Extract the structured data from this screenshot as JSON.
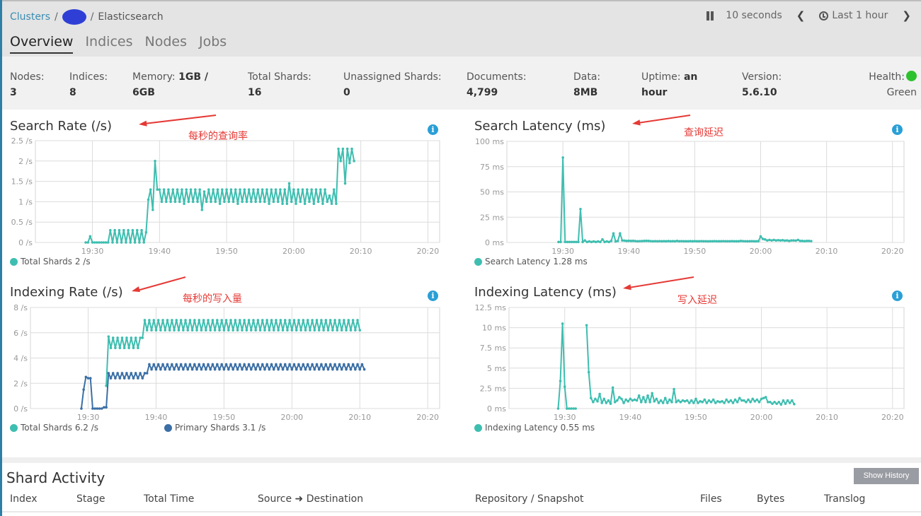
{
  "header": {
    "breadcrumb": {
      "clusters": "Clusters",
      "sep": "/",
      "current": "Elasticsearch"
    },
    "tabs": [
      {
        "label": "Overview",
        "active": true
      },
      {
        "label": "Indices",
        "active": false
      },
      {
        "label": "Nodes",
        "active": false
      },
      {
        "label": "Jobs",
        "active": false
      }
    ],
    "controls": {
      "pause_icon": "pause-icon",
      "refresh_interval": "10 seconds",
      "prev_icon": "chevron-left-icon",
      "clock_icon": "clock-icon",
      "time_range": "Last 1 hour",
      "next_icon": "chevron-right-icon"
    }
  },
  "stats": {
    "nodes": {
      "label": "Nodes:",
      "value": "3"
    },
    "indices": {
      "label": "Indices:",
      "value": "8"
    },
    "memory": {
      "label": "Memory:",
      "value_a": "1GB /",
      "value_b": "6GB"
    },
    "total_shards": {
      "label": "Total Shards:",
      "value": "16"
    },
    "unassigned_shards": {
      "label": "Unassigned Shards:",
      "value": "0"
    },
    "documents": {
      "label": "Documents:",
      "value": "4,799"
    },
    "data": {
      "label": "Data:",
      "value": "8MB"
    },
    "uptime": {
      "label": "Uptime:",
      "value_a": "an",
      "value_b": "hour"
    },
    "version": {
      "label": "Version:",
      "value": "5.6.10"
    },
    "health": {
      "label": "Health:",
      "value": "Green",
      "color": "#2ec12e"
    }
  },
  "colors": {
    "teal": "#3ebeb0",
    "blue": "#3b6fa6",
    "annotation": "#e53935",
    "info": "#2a9fd6"
  },
  "annotations": {
    "search_rate": "每秒的查询率",
    "search_latency": "查询延迟",
    "indexing_rate": "每秒的写入量",
    "indexing_latency": "写入延迟"
  },
  "chart_data": [
    {
      "id": "search_rate",
      "type": "line",
      "title": "Search Rate (/s)",
      "xlabel": "",
      "ylabel": "",
      "xlim": [
        "19:21:30",
        "20:21:45"
      ],
      "ylim": [
        0,
        2.5
      ],
      "yticks": [
        "0 /s",
        "0.5 /s",
        "1 /s",
        "1.5 /s",
        "2 /s",
        "2.5 /s"
      ],
      "ytick_values": [
        0,
        0.5,
        1,
        1.5,
        2,
        2.5
      ],
      "xticks": [
        "19:30",
        "19:40",
        "19:50",
        "20:00",
        "20:10",
        "20:20"
      ],
      "grid": true,
      "legend": [
        {
          "name": "Total Shards",
          "value": "2 /s",
          "color": "#3ebeb0"
        }
      ],
      "series": [
        {
          "name": "Total Shards",
          "color": "#3ebeb0",
          "x_start": "19:29:00",
          "x_step_seconds": 20,
          "values": [
            0,
            0,
            0.15,
            0,
            0,
            0,
            0,
            0,
            0,
            0,
            0,
            0.3,
            0,
            0.3,
            0,
            0.3,
            0,
            0.3,
            0,
            0.3,
            0,
            0.3,
            0,
            0.3,
            0,
            0.3,
            0,
            0.25,
            1.05,
            1.3,
            0.8,
            2,
            1.3,
            1.3,
            1,
            1.3,
            1,
            1.3,
            1,
            1.3,
            1,
            1.3,
            1,
            1.3,
            0.95,
            1.3,
            1,
            1.3,
            1,
            1.3,
            1,
            1.3,
            0.8,
            1.25,
            1,
            1.3,
            1,
            1.3,
            1,
            1.3,
            0.95,
            1.3,
            1,
            1.3,
            1,
            1.3,
            1,
            1.3,
            0.95,
            1.3,
            1,
            1.3,
            1,
            1.3,
            1,
            1.3,
            1,
            1.3,
            1,
            1.3,
            1,
            1.3,
            0.95,
            1.3,
            1,
            1.3,
            1,
            1.3,
            0.95,
            1.3,
            0.95,
            1.45,
            1,
            1.3,
            0.95,
            1.3,
            1,
            1.3,
            0.95,
            1.3,
            1,
            1.3,
            0.95,
            1.3,
            1,
            1.3,
            0.95,
            1.3,
            1,
            1.15,
            0.95,
            1.3,
            0.95,
            2.3,
            2,
            2.3,
            1.45,
            2.3,
            1.95,
            2.3,
            2
          ]
        }
      ]
    },
    {
      "id": "search_latency",
      "type": "line",
      "title": "Search Latency (ms)",
      "xlabel": "",
      "ylabel": "",
      "xlim": [
        "19:21:30",
        "20:21:45"
      ],
      "ylim": [
        0,
        100
      ],
      "yticks": [
        "0 ms",
        "25 ms",
        "50 ms",
        "75 ms",
        "100 ms"
      ],
      "ytick_values": [
        0,
        25,
        50,
        75,
        100
      ],
      "xticks": [
        "19:30",
        "19:40",
        "19:50",
        "20:00",
        "20:10",
        "20:20"
      ],
      "grid": true,
      "legend": [
        {
          "name": "Search Latency",
          "value": "1.28 ms",
          "color": "#3ebeb0"
        }
      ],
      "series": [
        {
          "name": "Search Latency",
          "color": "#3ebeb0",
          "x_start": "19:29:20",
          "x_step_seconds": 20,
          "values": [
            0.5,
            0.5,
            84,
            0.5,
            0.5,
            0.5,
            0.5,
            0.5,
            0.5,
            0.5,
            33,
            0.5,
            2,
            0.5,
            1,
            0.5,
            1,
            0.5,
            1,
            0.5,
            3,
            0.5,
            1,
            0.5,
            1.5,
            9,
            1,
            1.5,
            9,
            2,
            1.8,
            1.5,
            1.6,
            1.5,
            1.6,
            1.4,
            1.2,
            1.3,
            1.4,
            1.5,
            1.6,
            1.5,
            1.3,
            1.2,
            1.3,
            1.2,
            1.3,
            1.2,
            1.3,
            1.2,
            1.4,
            1.2,
            1.3,
            1.2,
            1.5,
            1.2,
            1.3,
            1.2,
            1.2,
            1.2,
            1.3,
            1.2,
            1.3,
            1.2,
            1.2,
            1.3,
            1.2,
            1.2,
            1.1,
            1.2,
            1.2,
            1.3,
            1.2,
            1.2,
            1.2,
            1.3,
            1.2,
            1.2,
            1.2,
            1.3,
            1.2,
            1.2,
            1.2,
            1.5,
            1.3,
            1.2,
            1.2,
            1.2,
            1.3,
            1.2,
            1.2,
            1.3,
            6,
            3.5,
            3,
            2,
            2.5,
            2,
            2.5,
            2,
            2.2,
            2,
            2.2,
            1.8,
            2,
            1.5,
            2,
            2,
            1.8,
            2.5,
            1.5,
            1.5,
            1.3,
            1.5,
            1.5,
            1.3
          ]
        }
      ]
    },
    {
      "id": "indexing_rate",
      "type": "line",
      "title": "Indexing Rate (/s)",
      "xlabel": "",
      "ylabel": "",
      "xlim": [
        "19:21:30",
        "20:21:45"
      ],
      "ylim": [
        0,
        8
      ],
      "yticks": [
        "0 /s",
        "2 /s",
        "4 /s",
        "6 /s",
        "8 /s"
      ],
      "ytick_values": [
        0,
        2,
        4,
        6,
        8
      ],
      "xticks": [
        "19:30",
        "19:40",
        "19:50",
        "20:00",
        "20:10",
        "20:20"
      ],
      "grid": true,
      "legend": [
        {
          "name": "Total Shards",
          "value": "6.2 /s",
          "color": "#3ebeb0"
        },
        {
          "name": "Primary Shards",
          "value": "3.1 /s",
          "color": "#3b6fa6"
        }
      ],
      "series": [
        {
          "name": "Total Shards",
          "color": "#3ebeb0",
          "x_start": "19:32:40",
          "x_step_seconds": 20,
          "values": [
            1.8,
            5.7,
            4.8,
            5.6,
            4.8,
            5.6,
            4.8,
            5.6,
            4.8,
            5.6,
            4.8,
            5.6,
            4.8,
            5.6,
            4.8,
            5.6,
            5.6,
            7,
            6.2,
            7,
            6.2,
            7,
            6.2,
            7,
            6.2,
            7,
            6.2,
            7,
            6.2,
            7,
            6.2,
            7,
            6.2,
            7,
            6.2,
            7,
            6.2,
            7,
            6.2,
            7,
            6.2,
            7,
            6.2,
            7,
            6.2,
            7,
            6.2,
            7,
            6.2,
            7,
            6.2,
            7,
            6.2,
            7,
            6.2,
            7,
            6.2,
            7,
            6.2,
            7,
            6.2,
            7,
            6.2,
            7,
            6.2,
            7,
            6.2,
            7,
            6.2,
            7,
            6.2,
            7,
            6.2,
            7,
            6.2,
            7,
            6.2,
            7,
            6.2,
            7,
            6.2,
            7,
            6.2,
            7,
            6.2,
            7,
            6.2,
            7,
            6.2,
            7,
            6.2,
            7,
            6.2,
            7,
            6.2,
            7,
            6.2,
            7,
            6.2,
            7,
            6.2,
            7,
            6.2,
            7,
            6.2,
            7,
            6.2,
            7,
            6.2,
            7,
            6.2,
            7,
            6.2
          ]
        },
        {
          "name": "Primary Shards",
          "color": "#3b6fa6",
          "x_start": "19:29:00",
          "x_step_seconds": 20,
          "values": [
            0,
            1.5,
            2.5,
            2.4,
            2.4,
            0,
            0,
            0,
            0,
            0,
            0.1,
            0.1,
            2.8,
            2.4,
            2.8,
            2.4,
            2.8,
            2.4,
            2.8,
            2.4,
            2.8,
            2.4,
            2.8,
            2.4,
            2.8,
            2.4,
            2.8,
            2.4,
            2.8,
            2.8,
            3.5,
            3.1,
            3.5,
            3.1,
            3.5,
            3.1,
            3.5,
            3.1,
            3.5,
            3.1,
            3.5,
            3.1,
            3.5,
            3.1,
            3.5,
            3.1,
            3.5,
            3.1,
            3.5,
            3.1,
            3.5,
            3.1,
            3.5,
            3.1,
            3.5,
            3.1,
            3.5,
            3.1,
            3.5,
            3.1,
            3.5,
            3.1,
            3.5,
            3.1,
            3.5,
            3.1,
            3.5,
            3.1,
            3.5,
            3.1,
            3.5,
            3.1,
            3.5,
            3.1,
            3.5,
            3.1,
            3.5,
            3.1,
            3.5,
            3.1,
            3.5,
            3.1,
            3.5,
            3.1,
            3.5,
            3.1,
            3.5,
            3.1,
            3.5,
            3.1,
            3.5,
            3.1,
            3.5,
            3.1,
            3.5,
            3.1,
            3.5,
            3.1,
            3.5,
            3.1,
            3.5,
            3.1,
            3.5,
            3.1,
            3.5,
            3.1,
            3.5,
            3.1,
            3.5,
            3.1,
            3.5,
            3.1,
            3.5,
            3.1,
            3.5,
            3.1,
            3.5,
            3.1,
            3.5,
            3.1,
            3.5,
            3.1,
            3.5,
            3.1,
            3.5,
            3.1
          ]
        }
      ]
    },
    {
      "id": "indexing_latency",
      "type": "line",
      "title": "Indexing Latency (ms)",
      "xlabel": "",
      "ylabel": "",
      "xlim": [
        "19:21:30",
        "20:21:45"
      ],
      "ylim": [
        0,
        12.5
      ],
      "yticks": [
        "0 ms",
        "2.5 ms",
        "5 ms",
        "7.5 ms",
        "10 ms",
        "12.5 ms"
      ],
      "ytick_values": [
        0,
        2.5,
        5,
        7.5,
        10,
        12.5
      ],
      "xticks": [
        "19:30",
        "19:40",
        "19:50",
        "20:00",
        "20:10",
        "20:20"
      ],
      "grid": true,
      "legend": [
        {
          "name": "Indexing Latency",
          "value": "0.55 ms",
          "color": "#3ebeb0"
        }
      ],
      "series": [
        {
          "name": "Indexing Latency",
          "color": "#3ebeb0",
          "segments": [
            {
              "x_start": "19:29:00",
              "x_step_seconds": 20,
              "values": [
                0,
                3.4,
                10.5,
                2.7,
                0,
                0,
                0,
                0,
                0
              ]
            },
            {
              "x_start": "19:33:20",
              "x_step_seconds": 20,
              "values": [
                10.3,
                4.5,
                1.3,
                0.8,
                1.2,
                0.9,
                1.8,
                0.7,
                1.2,
                0.7,
                1.0,
                0.6,
                2.6,
                0.8,
                1.0,
                1.4,
                1.2,
                0.7,
                1.1,
                0.9,
                1.2,
                1.0,
                1.1,
                1.0,
                1.6,
                0.8,
                1.4,
                0.8,
                1.6,
                0.8,
                1.9,
                0.9,
                1.2,
                0.7,
                1.0,
                0.7,
                1.3,
                0.7,
                1.1,
                0.8,
                2.4,
                0.8,
                1.0,
                0.8,
                1.0,
                0.9,
                1.0,
                0.7,
                1.0,
                0.7,
                1.2,
                0.7,
                0.9,
                0.8,
                1.1,
                0.7,
                1.0,
                0.8,
                1.1,
                0.7,
                0.9,
                0.8,
                0.9,
                0.7,
                1.1,
                0.8,
                1.0,
                0.7,
                1.1,
                0.8,
                1.3,
                1.0,
                1.0,
                0.8,
                1.1,
                0.8,
                1.2,
                0.9,
                1.1,
                0.8,
                1.2,
                1.3,
                1.4,
                0.8,
                0.8,
                0.6,
                0.8,
                0.6,
                0.8,
                0.5,
                1.0,
                0.6,
                1.0,
                0.7,
                1.0,
                0.55
              ]
            }
          ]
        }
      ]
    }
  ],
  "shard_activity": {
    "title": "Shard Activity",
    "show_history": "Show History",
    "columns": [
      "Index",
      "Stage",
      "Total Time",
      "Source",
      "Destination",
      "Repository / Snapshot",
      "Files",
      "Bytes",
      "Translog"
    ],
    "arrow_icon": "arrow-right-icon"
  }
}
